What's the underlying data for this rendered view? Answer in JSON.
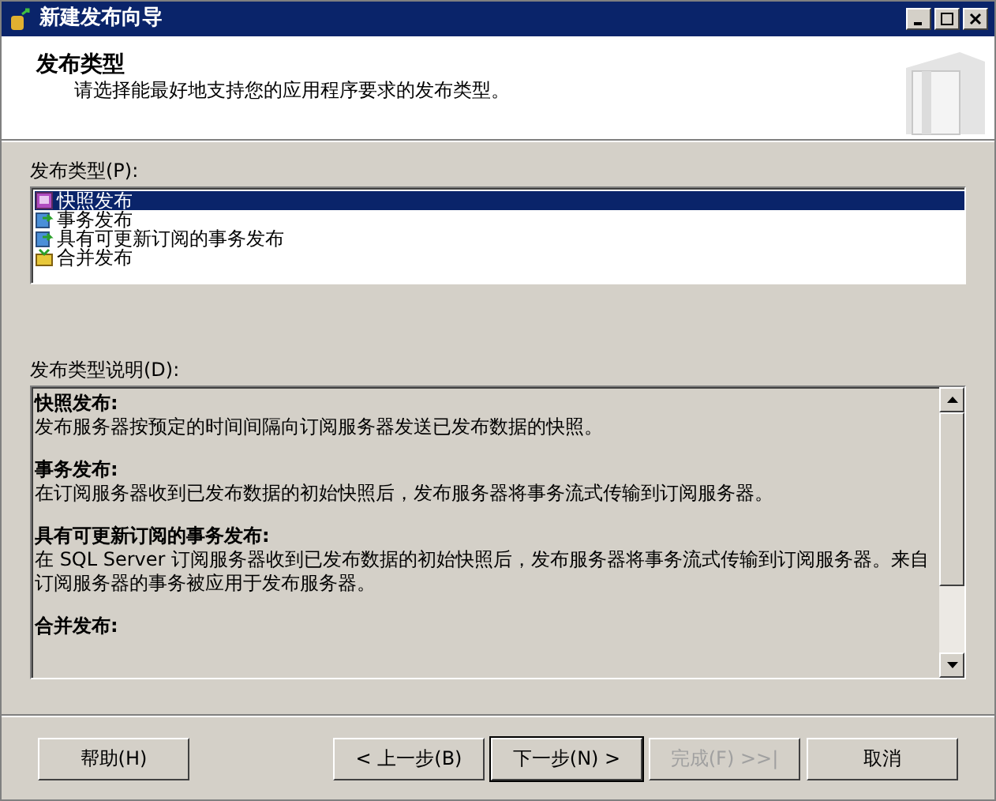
{
  "window": {
    "title": "新建发布向导"
  },
  "header": {
    "title": "发布类型",
    "subtitle": "请选择能最好地支持您的应用程序要求的发布类型。"
  },
  "publication_types": {
    "label": "发布类型(P):",
    "items": [
      {
        "label": "快照发布",
        "kind": "snapshot",
        "selected": true
      },
      {
        "label": "事务发布",
        "kind": "transactional",
        "selected": false
      },
      {
        "label": "具有可更新订阅的事务发布",
        "kind": "transactional",
        "selected": false
      },
      {
        "label": "合并发布",
        "kind": "merge",
        "selected": false
      }
    ]
  },
  "description": {
    "label": "发布类型说明(D):",
    "sections": [
      {
        "heading": "快照发布:",
        "text": "发布服务器按预定的时间间隔向订阅服务器发送已发布数据的快照。"
      },
      {
        "heading": "事务发布:",
        "text": "在订阅服务器收到已发布数据的初始快照后，发布服务器将事务流式传输到订阅服务器。"
      },
      {
        "heading": "具有可更新订阅的事务发布:",
        "text": "在 SQL Server 订阅服务器收到已发布数据的初始快照后，发布服务器将事务流式传输到订阅服务器。来自订阅服务器的事务被应用于发布服务器。"
      },
      {
        "heading": "合并发布:"
      }
    ]
  },
  "buttons": [
    {
      "label": "帮助(H)",
      "kind": "help",
      "disabled": false
    },
    {
      "label": "< 上一步(B)",
      "kind": "back",
      "disabled": false
    },
    {
      "label": "下一步(N) >",
      "kind": "next",
      "disabled": false
    },
    {
      "label": "完成(F) >>|",
      "kind": "finish",
      "disabled": true
    },
    {
      "label": "取消",
      "kind": "cancel",
      "disabled": false
    }
  ]
}
